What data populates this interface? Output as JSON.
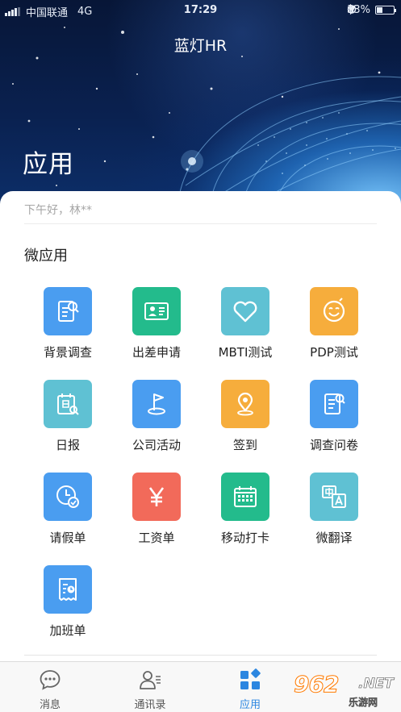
{
  "status_bar": {
    "carrier": "中国联通",
    "network": "4G",
    "time": "17:29",
    "battery": "33%",
    "battery_level": 0.33
  },
  "header": {
    "app_title": "蓝灯HR",
    "page_heading": "应用"
  },
  "greeting": "下午好，林**",
  "section_title": "微应用",
  "apps": [
    {
      "label": "背景调查",
      "icon": "document-search-icon",
      "color": "#4a9df0"
    },
    {
      "label": "出差申请",
      "icon": "id-card-icon",
      "color": "#23bb8c"
    },
    {
      "label": "MBTI测试",
      "icon": "heart-icon",
      "color": "#5fc1d3"
    },
    {
      "label": "PDP测试",
      "icon": "smiley-icon",
      "color": "#f6ad3c"
    },
    {
      "label": "日报",
      "icon": "calendar-search-icon",
      "color": "#5fc1d3"
    },
    {
      "label": "公司活动",
      "icon": "flag-icon",
      "color": "#4a9df0"
    },
    {
      "label": "签到",
      "icon": "location-pin-icon",
      "color": "#f6ad3c"
    },
    {
      "label": "调查问卷",
      "icon": "survey-search-icon",
      "color": "#4a9df0"
    },
    {
      "label": "请假单",
      "icon": "clock-check-icon",
      "color": "#4a9df0"
    },
    {
      "label": "工资单",
      "icon": "yen-icon",
      "color": "#f26a5a"
    },
    {
      "label": "移动打卡",
      "icon": "calendar-grid-icon",
      "color": "#23bb8c"
    },
    {
      "label": "微翻译",
      "icon": "translate-icon",
      "color": "#5fc1d3"
    },
    {
      "label": "加班单",
      "icon": "receipt-clock-icon",
      "color": "#4a9df0"
    }
  ],
  "tabs": [
    {
      "label": "消息",
      "icon": "chat-bubble-icon",
      "active": false
    },
    {
      "label": "通讯录",
      "icon": "contacts-icon",
      "active": false
    },
    {
      "label": "应用",
      "icon": "apps-grid-icon",
      "active": true
    }
  ],
  "watermark": {
    "main": "962",
    "suffix": ".NET",
    "sub": "乐游网"
  },
  "colors": {
    "accent": "#2b86e0",
    "hero_dark": "#071637"
  }
}
